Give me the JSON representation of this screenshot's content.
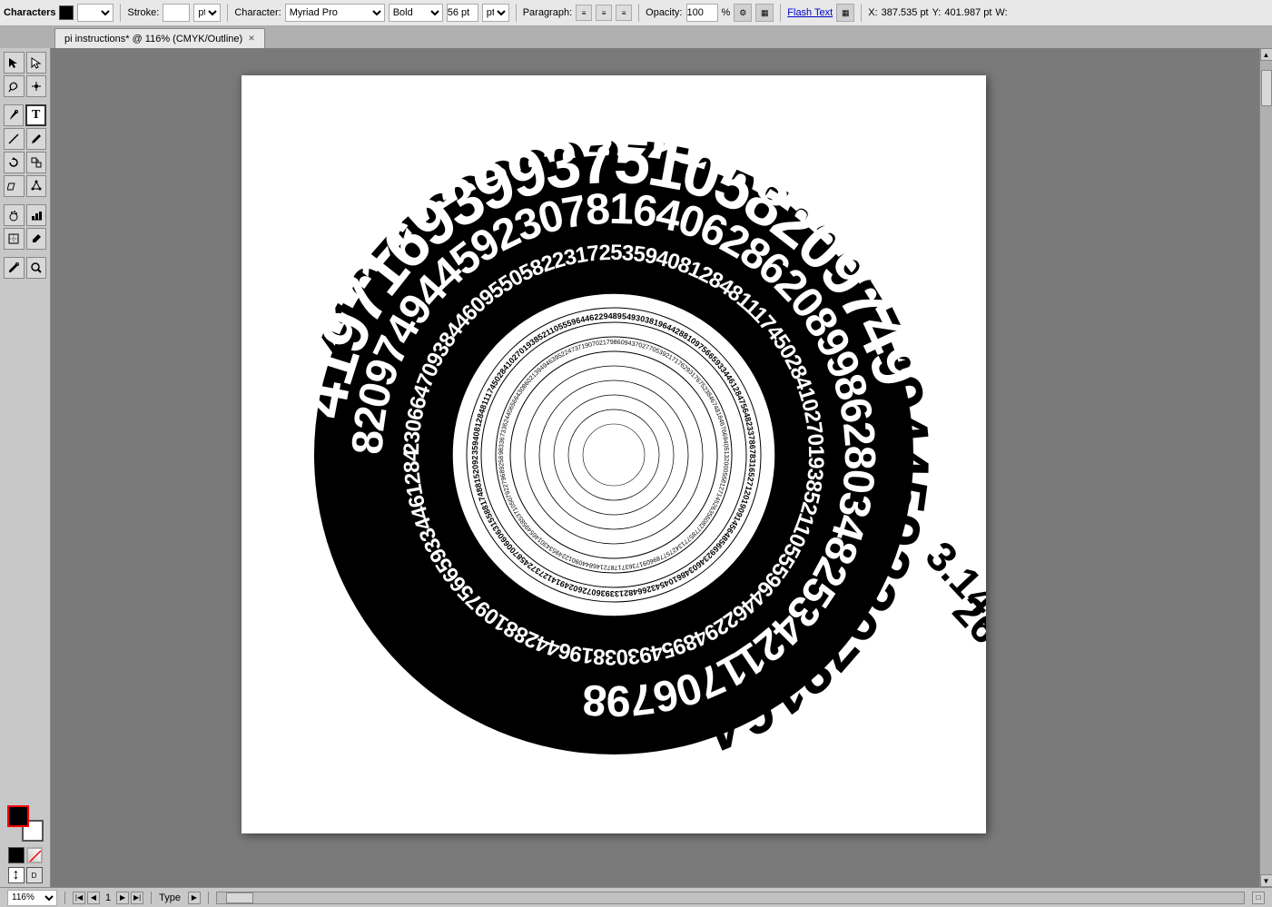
{
  "app": {
    "title": "Characters"
  },
  "toolbar": {
    "panel_label": "Characters",
    "stroke_label": "Stroke:",
    "character_label": "Character:",
    "font_family": "Myriad Pro",
    "font_weight": "Bold",
    "font_size": "56 pt",
    "paragraph_label": "Paragraph:",
    "opacity_label": "Opacity:",
    "opacity_value": "100",
    "opacity_unit": "%",
    "flash_text_label": "Flash Text",
    "x_label": "X:",
    "x_value": "387.535 pt",
    "y_label": "Y:",
    "y_value": "401.987 pt"
  },
  "tab": {
    "title": "pi instructions*",
    "zoom": "116%",
    "color_mode": "CMYK/Outline"
  },
  "bottom_bar": {
    "zoom_level": "116%",
    "page_number": "1",
    "type_label": "Type"
  },
  "tools": [
    {
      "id": "select",
      "icon": "↖",
      "active": false
    },
    {
      "id": "direct-select",
      "icon": "↗",
      "active": false
    },
    {
      "id": "lasso",
      "icon": "⌖",
      "active": false
    },
    {
      "id": "pen",
      "icon": "✒",
      "active": false
    },
    {
      "id": "text",
      "icon": "T",
      "active": true
    },
    {
      "id": "line",
      "icon": "╱",
      "active": false
    },
    {
      "id": "shape",
      "icon": "○",
      "active": false
    },
    {
      "id": "rotate",
      "icon": "↻",
      "active": false
    },
    {
      "id": "scale",
      "icon": "⤡",
      "active": false
    },
    {
      "id": "shear",
      "icon": "⟁",
      "active": false
    },
    {
      "id": "gradient",
      "icon": "▣",
      "active": false
    },
    {
      "id": "eyedropper",
      "icon": "🔦",
      "active": false
    },
    {
      "id": "zoom",
      "icon": "🔍",
      "active": false
    },
    {
      "id": "hand",
      "icon": "✋",
      "active": false
    }
  ]
}
